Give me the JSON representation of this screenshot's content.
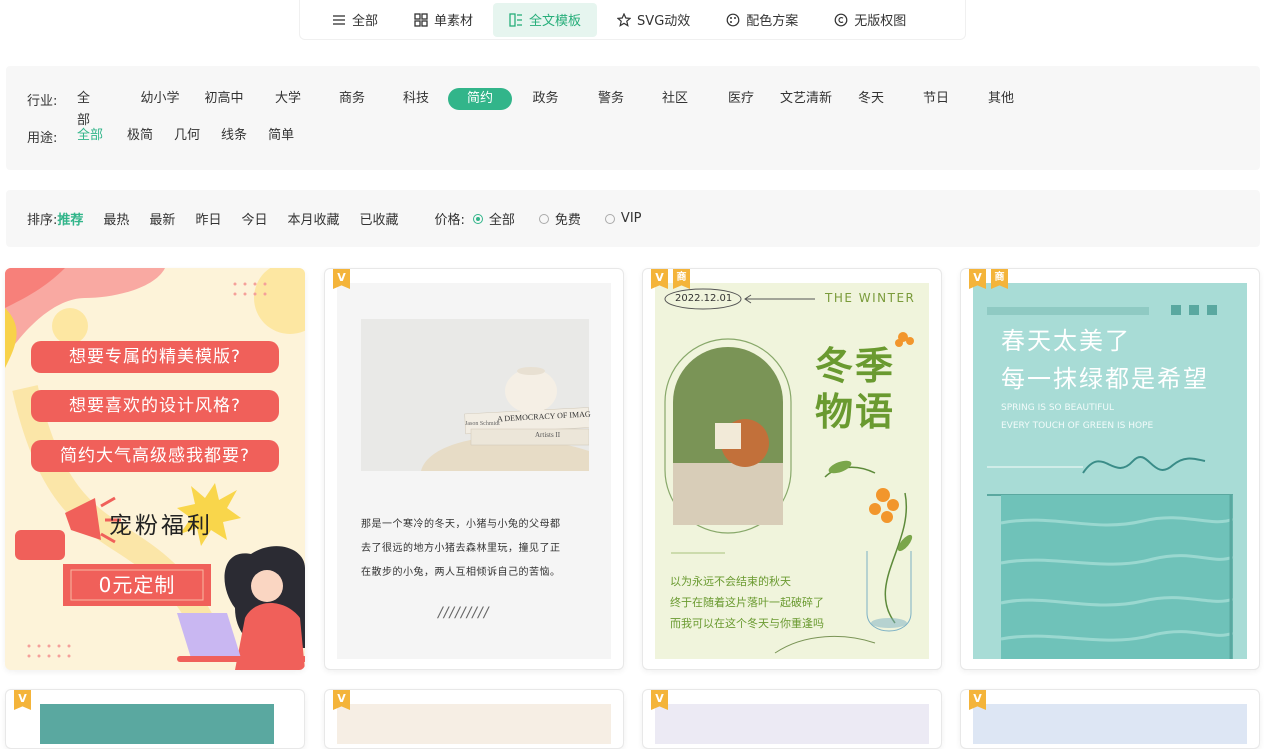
{
  "nav": {
    "tabs": [
      {
        "label": "全部",
        "icon": "list-icon"
      },
      {
        "label": "单素材",
        "icon": "grid-icon"
      },
      {
        "label": "全文模板",
        "icon": "template-icon",
        "active": true
      },
      {
        "label": "SVG动效",
        "icon": "star-icon"
      },
      {
        "label": "配色方案",
        "icon": "palette-icon"
      },
      {
        "label": "无版权图",
        "icon": "copyright-icon"
      }
    ]
  },
  "filters": {
    "industry_label": "行业:",
    "industry": [
      "全部",
      "幼小学",
      "初高中",
      "大学",
      "商务",
      "科技",
      "简约",
      "政务",
      "警务",
      "社区",
      "医疗",
      "文艺清新",
      "冬天",
      "节日",
      "其他"
    ],
    "usage_label": "用途:",
    "usage": [
      "全部",
      "极简",
      "几何",
      "线条",
      "简单"
    ]
  },
  "sort": {
    "label": "排序:",
    "items": [
      "推荐",
      "最热",
      "最新",
      "昨日",
      "今日",
      "本月收藏",
      "已收藏"
    ],
    "price_label": "价格:",
    "price_options": [
      "全部",
      "免费",
      "VIP"
    ]
  },
  "badges": {
    "v": "V",
    "shang": "商"
  },
  "cards": {
    "c1": {
      "bubbles": [
        "想要专属的精美模版?",
        "想要喜欢的设计风格?",
        "简约大气高级感我都要?"
      ],
      "title": "宠粉福利",
      "button": "0元定制"
    },
    "c2": {
      "book1": "A DEMOCRACY OF IMAG",
      "book2": "Artists II",
      "book3": "Jason Schmidt",
      "text": [
        "那是一个寒冷的冬天，小猪与小兔的父母都",
        "去了很远的地方小猪去森林里玩，撞见了正",
        "在散步的小兔，两人互相倾诉自己的苦恼。"
      ],
      "slashes": "/////////"
    },
    "c3": {
      "date": "2022.12.01",
      "season": "THE WINTER",
      "title1": "冬季",
      "title2": "物语",
      "lines": [
        "以为永远不会结束的秋天",
        "终于在随着这片落叶一起破碎了",
        "而我可以在这个冬天与你重逢吗"
      ]
    },
    "c4": {
      "title1": "春天太美了",
      "title2": "每一抹绿都是希望",
      "en1": "SPRING IS SO BEAUTIFUL",
      "en2": "EVERY TOUCH OF GREEN IS HOPE"
    }
  },
  "colors": {
    "accent": "#32b58a",
    "badge": "#f4b43a"
  }
}
